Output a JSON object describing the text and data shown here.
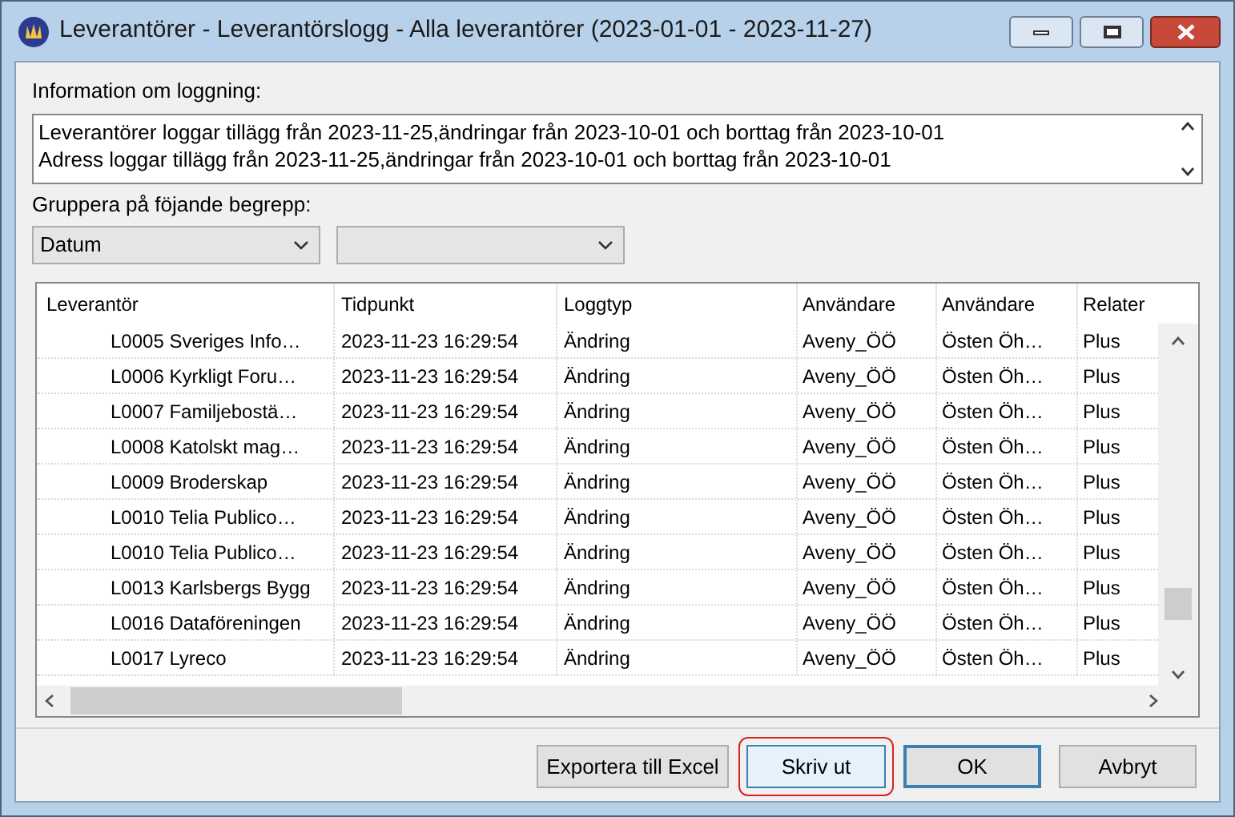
{
  "window": {
    "title": "Leverantörer - Leverantörslogg - Alla leverantörer (2023-01-01 - 2023-11-27)"
  },
  "info": {
    "label": "Information om loggning:",
    "lines": [
      "Leverantörer loggar tillägg från 2023-11-25,ändringar från 2023-10-01 och borttag från 2023-10-01",
      "Adress loggar tillägg från 2023-11-25,ändringar från 2023-10-01 och borttag från 2023-10-01"
    ]
  },
  "grouping": {
    "label": "Gruppera på föjande begrepp:",
    "combos": [
      {
        "kind": "dropdown",
        "value": "Datum"
      },
      {
        "kind": "dropdown"
      }
    ]
  },
  "table": {
    "columns": [
      "Leverantör",
      "Tidpunkt",
      "Loggtyp",
      "Användare",
      "Användare",
      "Relater"
    ],
    "rows": [
      [
        "L0005 Sveriges Info…",
        "2023-11-23 16:29:54",
        "Ändring",
        "Aveny_ÖÖ",
        "Östen Öh…",
        "Plus"
      ],
      [
        "L0006 Kyrkligt Foru…",
        "2023-11-23 16:29:54",
        "Ändring",
        "Aveny_ÖÖ",
        "Östen Öh…",
        "Plus"
      ],
      [
        "L0007 Familjebostä…",
        "2023-11-23 16:29:54",
        "Ändring",
        "Aveny_ÖÖ",
        "Östen Öh…",
        "Plus"
      ],
      [
        "L0008 Katolskt mag…",
        "2023-11-23 16:29:54",
        "Ändring",
        "Aveny_ÖÖ",
        "Östen Öh…",
        "Plus"
      ],
      [
        "L0009 Broderskap",
        "2023-11-23 16:29:54",
        "Ändring",
        "Aveny_ÖÖ",
        "Östen Öh…",
        "Plus"
      ],
      [
        "L0010 Telia Publico…",
        "2023-11-23 16:29:54",
        "Ändring",
        "Aveny_ÖÖ",
        "Östen Öh…",
        "Plus"
      ],
      [
        "L0010 Telia Publico…",
        "2023-11-23 16:29:54",
        "Ändring",
        "Aveny_ÖÖ",
        "Östen Öh…",
        "Plus"
      ],
      [
        "L0013 Karlsbergs Bygg",
        "2023-11-23 16:29:54",
        "Ändring",
        "Aveny_ÖÖ",
        "Östen Öh…",
        "Plus"
      ],
      [
        "L0016 Dataföreningen",
        "2023-11-23 16:29:54",
        "Ändring",
        "Aveny_ÖÖ",
        "Östen Öh…",
        "Plus"
      ],
      [
        "L0017 Lyreco",
        "2023-11-23 16:29:54",
        "Ändring",
        "Aveny_ÖÖ",
        "Östen Öh…",
        "Plus"
      ]
    ]
  },
  "buttons": [
    {
      "label": "Exportera till Excel",
      "default": false,
      "highlighted": false
    },
    {
      "label": "Skriv ut",
      "default": false,
      "highlighted": true
    },
    {
      "label": "OK",
      "default": true,
      "highlighted": false
    },
    {
      "label": "Avbryt",
      "default": false,
      "highlighted": false
    }
  ]
}
